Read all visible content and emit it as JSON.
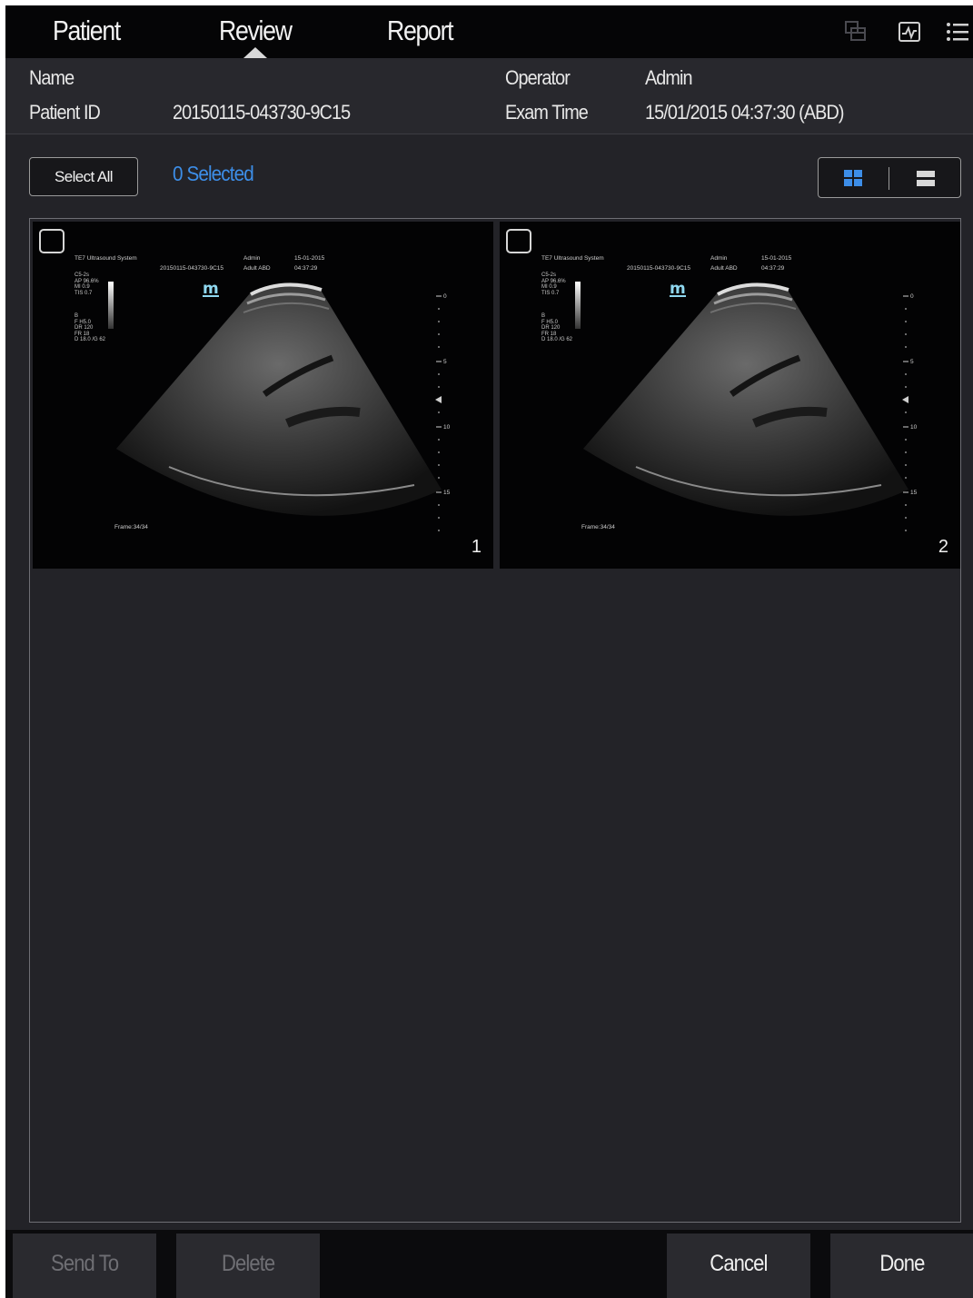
{
  "tabs": [
    {
      "label": "Patient"
    },
    {
      "label": "Review",
      "active": true
    },
    {
      "label": "Report"
    }
  ],
  "top_icons": [
    "layers-icon",
    "waveform-icon",
    "list-menu-icon"
  ],
  "patient_info": {
    "name_label": "Name",
    "name_value": "",
    "patient_id_label": "Patient ID",
    "patient_id_value": "20150115-043730-9C15",
    "operator_label": "Operator",
    "operator_value": "Admin",
    "exam_time_label": "Exam Time",
    "exam_time_value": "15/01/2015 04:37:30 (ABD)"
  },
  "toolbar": {
    "select_all_label": "Select All",
    "selected_count": "0 Selected",
    "view_modes": [
      "grid-view-icon",
      "list-view-icon"
    ],
    "active_view": "grid"
  },
  "thumbnails": [
    {
      "index": "1",
      "checked": false,
      "overlay": {
        "system": "TE7 Ultrasound System",
        "exam_id": "20150115-043730-9C15",
        "operator": "Admin",
        "preset": "Adult ABD",
        "date": "15-01-2015",
        "time": "04:37:29",
        "params_1": "C5-2s\nAP 96.6%\nMI 0.9\nTIS 0.7",
        "params_2": "B\nF H5.0\nDR 120\nFR 18\nD 18.0 /G 62",
        "logo": "m",
        "frame": "Frame:34/34",
        "depth_ticks": [
          "0",
          "5",
          "10",
          "15"
        ]
      }
    },
    {
      "index": "2",
      "checked": false,
      "overlay": {
        "system": "TE7 Ultrasound System",
        "exam_id": "20150115-043730-9C15",
        "operator": "Admin",
        "preset": "Adult ABD",
        "date": "15-01-2015",
        "time": "04:37:29",
        "params_1": "C5-2s\nAP 96.6%\nMI 0.9\nTIS 0.7",
        "params_2": "B\nF H5.0\nDR 120\nFR 18\nD 18.0 /G 62",
        "logo": "m",
        "frame": "Frame:34/34",
        "depth_ticks": [
          "0",
          "5",
          "10",
          "15"
        ]
      }
    }
  ],
  "bottom_bar": {
    "send_to_label": "Send To",
    "delete_label": "Delete",
    "cancel_label": "Cancel",
    "done_label": "Done",
    "send_to_enabled": false,
    "delete_enabled": false
  },
  "colors": {
    "background": "#232328",
    "topbar": "#050506",
    "accent_blue": "#3d8ee8",
    "disabled_text": "#6f6f74"
  }
}
